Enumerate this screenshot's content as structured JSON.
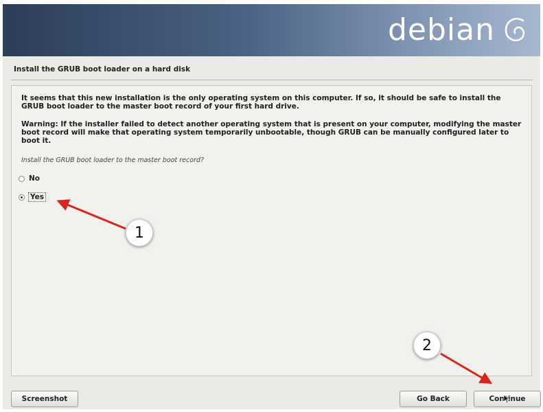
{
  "header": {
    "logo_text": "debian",
    "logo_icon": "debian-swirl-icon"
  },
  "step": {
    "title": "Install the GRUB boot loader on a hard disk"
  },
  "content": {
    "paragraph1": "It seems that this new installation is the only operating system on this computer. If so, it should be safe to install the GRUB boot loader to the master boot record of your first hard drive.",
    "paragraph2": "Warning: If the installer failed to detect another operating system that is present on your computer, modifying the master boot record will make that operating system temporarily unbootable, though GRUB can be manually configured later to boot it.",
    "question": "Install the GRUB boot loader to the master boot record?",
    "options": [
      {
        "label": "No",
        "selected": false
      },
      {
        "label": "Yes",
        "selected": true
      }
    ]
  },
  "buttons": {
    "screenshot": "Screenshot",
    "go_back": "Go Back",
    "continue": "Continue"
  },
  "annotations": {
    "marker1": "1",
    "marker2": "2",
    "arrow_color": "#d9261c"
  }
}
